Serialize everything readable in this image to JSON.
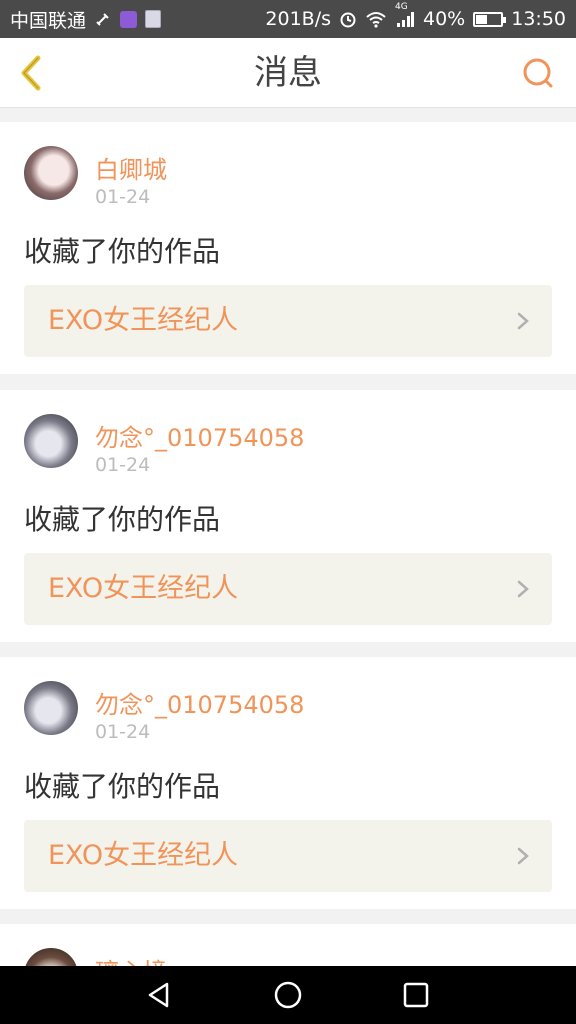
{
  "status_bar": {
    "carrier": "中国联通",
    "speed": "201B/s",
    "network": "4G",
    "battery": "40%",
    "battery_level": 0.4,
    "time": "13:50"
  },
  "header": {
    "title": "消息"
  },
  "messages": [
    {
      "user": "白卿城",
      "date": "01-24",
      "action": "收藏了你的作品",
      "work_title": "EXO女王经纪人"
    },
    {
      "user": "勿念°_010754058",
      "date": "01-24",
      "action": "收藏了你的作品",
      "work_title": "EXO女王经纪人"
    },
    {
      "user": "勿念°_010754058",
      "date": "01-24",
      "action": "收藏了你的作品",
      "work_title": "EXO女王经纪人"
    },
    {
      "user": "璃心境",
      "date": "",
      "action": "",
      "work_title": ""
    }
  ],
  "colors": {
    "accent": "#f0945a",
    "back_arrow": "#e8c53a",
    "status_bar": "#4a4a4a",
    "card_work_bg": "#f3f3ec"
  }
}
